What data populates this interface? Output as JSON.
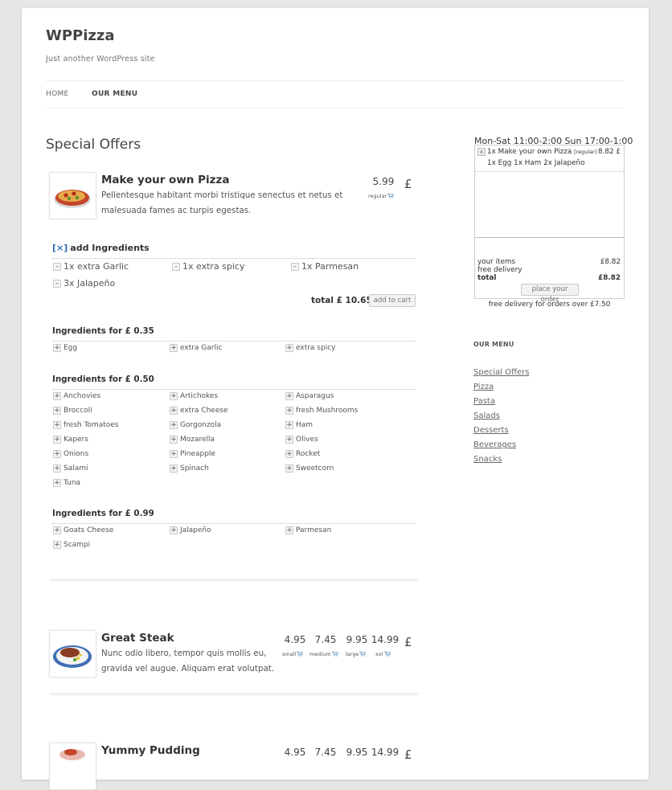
{
  "site": {
    "title": "WPPizza",
    "tagline": "Just another WordPress site"
  },
  "nav": {
    "items": [
      {
        "label": "HOME"
      },
      {
        "label": "OUR MENU"
      }
    ]
  },
  "content": {
    "heading": "Special Offers",
    "items": [
      {
        "title": "Make your own Pizza",
        "desc": "Pellentesque habitant morbi tristique senectus et netus et malesuada fames ac turpis egestas.",
        "prices": [
          {
            "value": "5.99",
            "label": "regular"
          }
        ],
        "currency": "£"
      },
      {
        "title": "Great Steak",
        "desc": "Nunc odio libero, tempor quis mollis eu, gravida vel augue. Aliquam erat volutpat.",
        "prices": [
          {
            "value": "4.95",
            "label": "small"
          },
          {
            "value": "7.45",
            "label": "medium"
          },
          {
            "value": "9.95",
            "label": "large"
          },
          {
            "value": "14.99",
            "label": "xxl"
          }
        ],
        "currency": "£"
      },
      {
        "title": "Yummy Pudding",
        "prices": [
          {
            "value": "4.95"
          },
          {
            "value": "7.45"
          },
          {
            "value": "9.95"
          },
          {
            "value": "14.99"
          }
        ],
        "currency": "£"
      }
    ]
  },
  "ingredients": {
    "close_label": "[×]",
    "add_title": "add Ingredients",
    "selected": [
      "1x extra Garlic",
      "1x extra spicy",
      "1x Parmesan",
      "3x Jalapeño"
    ],
    "total_label": "total £ 10.65",
    "add_to_cart": "add to cart",
    "minus": "-",
    "plus": "+",
    "groups": [
      {
        "title": "Ingredients for £ 0.35",
        "items": [
          "Egg",
          "extra Garlic",
          "extra spicy"
        ]
      },
      {
        "title": "Ingredients for £ 0.50",
        "items": [
          "Anchovies",
          "Artichokes",
          "Asparagus",
          "Broccoli",
          "extra Cheese",
          "fresh Mushrooms",
          "fresh Tomatoes",
          "Gorgonzola",
          "Ham",
          "Kapers",
          "Mozarella",
          "Olives",
          "Onions",
          "Pineapple",
          "Rocket",
          "Salami",
          "Spinach",
          "Sweetcorn",
          "Tuna"
        ]
      },
      {
        "title": "Ingredients for £ 0.99",
        "items": [
          "Goats Cheese",
          "Jalapeño",
          "Parmesan",
          "Scampi"
        ]
      }
    ]
  },
  "cart": {
    "hours": "Mon-Sat 11:00-2:00 Sun 17:00-1:00",
    "remove_label": "x",
    "line_main": "1x Make your own Pizza",
    "line_size": "[regular]",
    "line_price": "8.82 £",
    "line_extras": "1x Egg 1x Ham 2x Jalapeño",
    "your_items_label": "your items",
    "your_items_value": "£8.82",
    "free_delivery_label": "free delivery",
    "total_label": "total",
    "total_value": "£8.82",
    "place_order": "place your order",
    "free_delivery_note": "free delivery for orders over £7.50"
  },
  "sidebar_menu": {
    "title": "OUR MENU",
    "links": [
      "Special Offers",
      "Pizza",
      "Pasta",
      "Salads",
      "Desserts",
      "Beverages",
      "Snacks"
    ]
  }
}
